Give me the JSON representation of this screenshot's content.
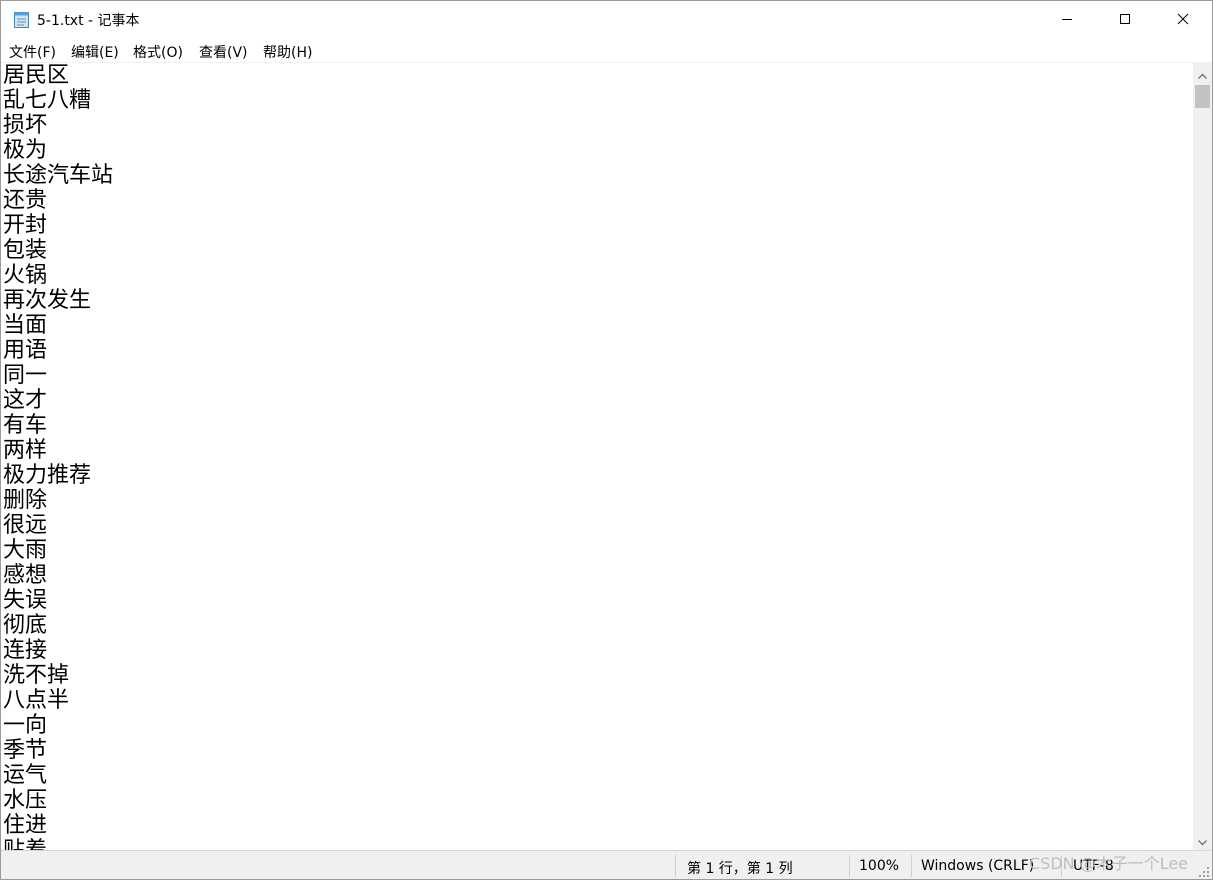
{
  "window": {
    "title": "5-1.txt - 记事本",
    "icon": "notepad-icon",
    "controls": [
      "minimize-icon",
      "maximize-icon",
      "close-icon"
    ]
  },
  "menu": {
    "items": [
      {
        "label": "文件(F)"
      },
      {
        "label": "编辑(E)"
      },
      {
        "label": "格式(O)"
      },
      {
        "label": "查看(V)"
      },
      {
        "label": "帮助(H)"
      }
    ]
  },
  "editor": {
    "lines": [
      "居民区",
      "乱七八糟",
      "损坏",
      "极为",
      "长途汽车站",
      "还贵",
      "开封",
      "包装",
      "火锅",
      "再次发生",
      "当面",
      "用语",
      "同一",
      "这才",
      "有车",
      "两样",
      "极力推荐",
      "删除",
      "很远",
      "大雨",
      "感想",
      "失误",
      "彻底",
      "连接",
      "洗不掉",
      "八点半",
      "一向",
      "季节",
      "运气",
      "水压",
      "住进",
      "贴着"
    ]
  },
  "statusbar": {
    "position": "第 1 行，第 1 列",
    "zoom": "100%",
    "line_ending": "Windows (CRLF)",
    "encoding": "UTF-8"
  },
  "watermark": "CSDN @木子一个Lee",
  "colors": {
    "statusbar_bg": "#f0f0f0",
    "scroll_thumb": "#c2c2c2",
    "text": "#000000"
  }
}
